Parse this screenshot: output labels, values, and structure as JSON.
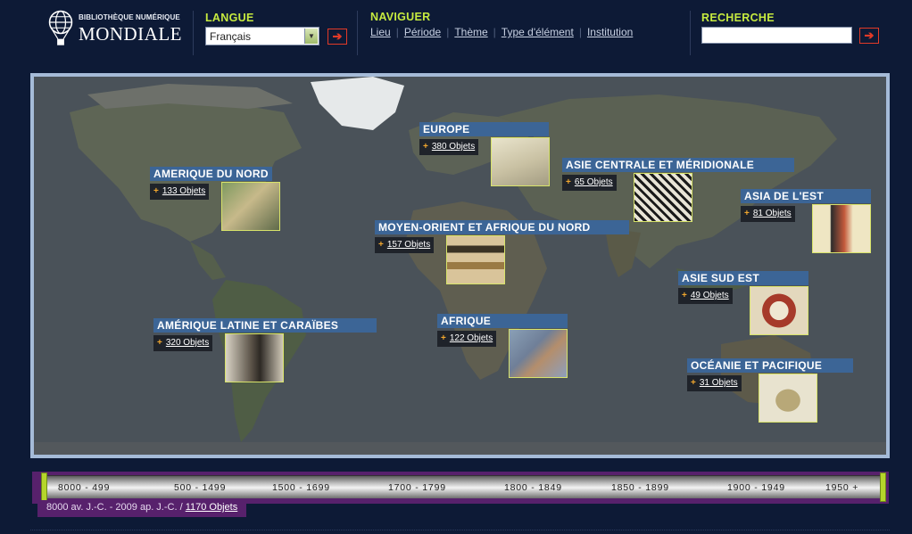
{
  "logo": {
    "line1": "BIBLIOTHÈQUE NUMÉRIQUE",
    "line2": "MONDIALE"
  },
  "langue": {
    "title": "LANGUE",
    "selected": "Français",
    "go": "➔"
  },
  "naviguer": {
    "title": "NAVIGUER",
    "links": [
      "Lieu",
      "Période",
      "Thème",
      "Type d'élément",
      "Institution"
    ]
  },
  "recherche": {
    "title": "RECHERCHE",
    "value": "",
    "go": "➔"
  },
  "regions": [
    {
      "name": "AMERIQUE DU NORD",
      "count": "133 Objets"
    },
    {
      "name": "EUROPE",
      "count": "380 Objets"
    },
    {
      "name": "ASIE CENTRALE ET MÉRIDIONALE",
      "count": "65 Objets"
    },
    {
      "name": "ASIA DE L'EST",
      "count": "81 Objets"
    },
    {
      "name": "MOYEN-ORIENT ET AFRIQUE DU NORD",
      "count": "157 Objets"
    },
    {
      "name": "ASIE SUD EST",
      "count": "49 Objets"
    },
    {
      "name": "AMÉRIQUE LATINE ET CARAÏBES",
      "count": "320 Objets"
    },
    {
      "name": "AFRIQUE",
      "count": "122 Objets"
    },
    {
      "name": "OCÉANIE ET PACIFIQUE",
      "count": "31 Objets"
    }
  ],
  "timeline": {
    "periods": [
      "8000 - 499",
      "500 - 1499",
      "1500 - 1699",
      "1700 - 1799",
      "1800 - 1849",
      "1850 - 1899",
      "1900 - 1949",
      "1950 +"
    ],
    "summary_range": "8000 av. J.-C. - 2009 ap. J.-C. / ",
    "summary_count": "1170 Objets"
  },
  "colors": {
    "accent_green": "#c6ea3f",
    "region_blue": "#3c6596",
    "timeline_purple": "#57216c",
    "go_red": "#e23a27"
  }
}
